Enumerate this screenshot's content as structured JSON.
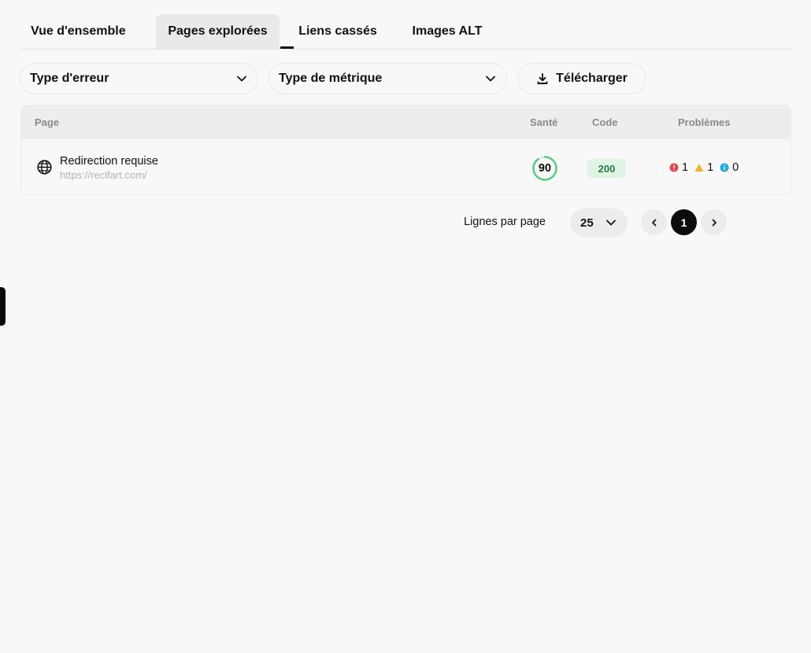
{
  "tabs": [
    {
      "label": "Vue d'ensemble"
    },
    {
      "label": "Pages explorées",
      "active": true
    },
    {
      "label": "Liens cassés"
    },
    {
      "label": "Images ALT"
    }
  ],
  "filters": {
    "error_type": "Type d'erreur",
    "metric_type": "Type de métrique",
    "download": "Télécharger"
  },
  "table": {
    "headers": {
      "page": "Page",
      "health": "Santé",
      "code": "Code",
      "issues": "Problèmes"
    },
    "rows": [
      {
        "title": "Redirection requise",
        "url": "https://recifart.com/",
        "health": "90",
        "health_fraction": 0.9,
        "code": "200",
        "errors": "1",
        "warnings": "1",
        "notices": "0"
      }
    ]
  },
  "pagination": {
    "rows_label": "Lignes par page",
    "rows_per_page": "25",
    "current_page": "1"
  },
  "colors": {
    "health_ring": "#5cc98a",
    "code_bg": "#e0f4e5",
    "error": "#e04848",
    "warning": "#f0b23a",
    "notice": "#1ea8e0"
  }
}
